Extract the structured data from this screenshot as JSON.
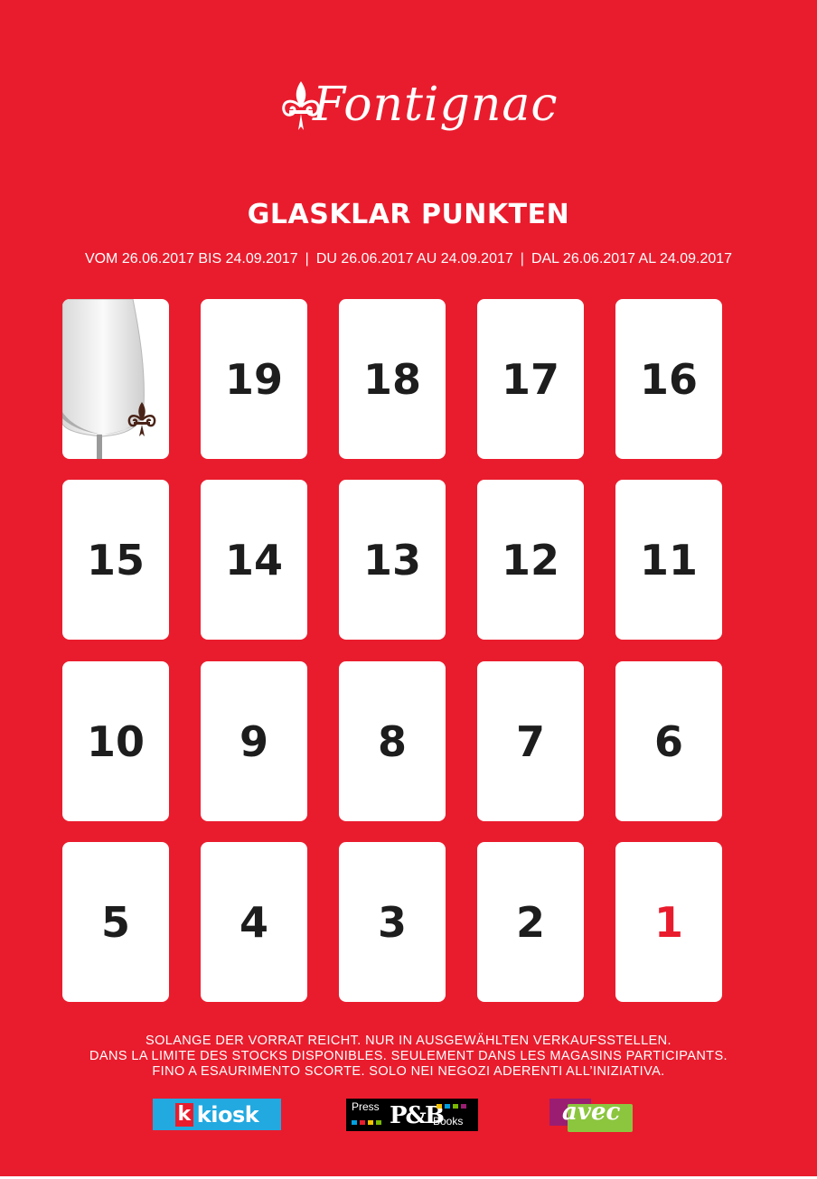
{
  "brand": {
    "name": "Fontignac"
  },
  "header": {
    "title": "GLASKLAR PUNKTEN",
    "dates": [
      "VOM 26.06.2017 BIS 24.09.2017",
      "DU 26.06.2017 AU 24.09.2017",
      "DAL 26.06.2017 AL 24.09.2017"
    ],
    "separator": "|"
  },
  "grid": {
    "cells": [
      "19",
      "18",
      "17",
      "16",
      "15",
      "14",
      "13",
      "12",
      "11",
      "10",
      "9",
      "8",
      "7",
      "6",
      "5",
      "4",
      "3",
      "2",
      "1"
    ],
    "highlight_value": "1"
  },
  "footer": {
    "lines": [
      "SOLANGE DER VORRAT REICHT. NUR IN AUSGEWÄHLTEN VERKAUFSSTELLEN.",
      "DANS LA LIMITE DES STOCKS DISPONIBLES. SEULEMENT DANS LES MAGASINS PARTICIPANTS.",
      "FINO A ESAURIMENTO SCORTE. SOLO NEI NEGOZI ADERENTI ALL’INIZIATIVA."
    ]
  },
  "partners": {
    "kiosk": {
      "mark": "k",
      "name": "kiosk",
      "color": "#22a9e0"
    },
    "press": {
      "press": "Press",
      "pb": "P&B",
      "books": "Books"
    },
    "avec": {
      "name": "avec"
    }
  },
  "colors": {
    "background": "#e91c2d",
    "tile": "#ffffff",
    "number": "#1d1d1d",
    "accent": "#e91c2d"
  }
}
